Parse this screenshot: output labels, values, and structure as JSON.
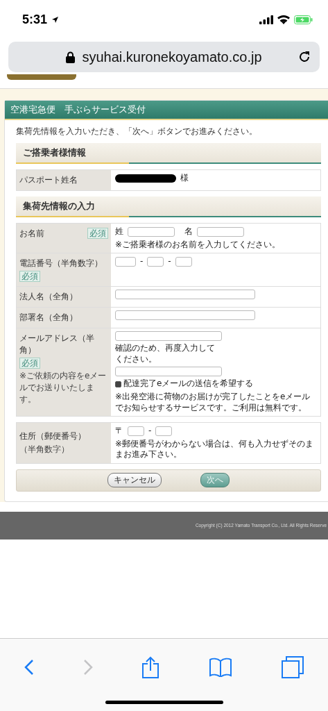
{
  "status_bar": {
    "time": "5:31"
  },
  "address_bar": {
    "url": "syuhai.kuronekoyamato.co.jp"
  },
  "page_title": "空港宅急便　手ぶらサービス受付",
  "intro": "集荷先情報を入力いただき、「次へ」ボタンでお進みください。",
  "sections": [
    {
      "heading": "ご搭乗者様情報",
      "tables": [
        [
          {
            "kind": "passport",
            "label": "パスポート姓名",
            "suffix": "様"
          }
        ]
      ]
    },
    {
      "heading": "集荷先情報の入力",
      "tables": [
        [
          {
            "kind": "name",
            "label": "お名前",
            "badge": "必須",
            "last_label": "姓",
            "first_label": "名",
            "note": "※ご搭乗者様のお名前を入力してください。"
          },
          {
            "kind": "phone",
            "label": "電話番号（半角数字）",
            "badge": "必須",
            "separators": [
              "-",
              "-"
            ]
          },
          {
            "kind": "text",
            "label": "法人名（全角）"
          },
          {
            "kind": "text",
            "label": "部署名（全角）"
          },
          {
            "kind": "email",
            "label": "メールアドレス（半角）",
            "badge": "必須",
            "label_note": "※ご依頼の内容をeメールでお送りいたします。",
            "confirm": "確認のため、再度入力してください。",
            "option": {
              "label": "配達完了eメールの送信を希望する",
              "checked": true
            },
            "info": "※出発空港に荷物のお届けが完了したことをeメールでお知らせするサービスです。ご利用は無料です。"
          }
        ],
        [
          {
            "kind": "postal",
            "label": "住所（郵便番号）",
            "label_2": "（半角数字）",
            "mark": "〒",
            "separator": "-",
            "note": "※郵便番号がわからない場合は、何も入力せずそのままお進み下さい。"
          }
        ]
      ]
    }
  ],
  "buttons": [
    {
      "label": "キャンセル",
      "kind": "secondary"
    },
    {
      "label": "次へ",
      "kind": "primary"
    }
  ],
  "footer": {
    "copyright": "Copyright (C) 2012 Yamato Transport Co., Ltd. All Rights Reserve"
  },
  "toolbar": [
    {
      "kind": "back",
      "disabled": false
    },
    {
      "kind": "forward",
      "disabled": true
    },
    {
      "kind": "share",
      "disabled": false
    },
    {
      "kind": "bookmarks",
      "disabled": false
    },
    {
      "kind": "tabs",
      "disabled": false
    }
  ]
}
